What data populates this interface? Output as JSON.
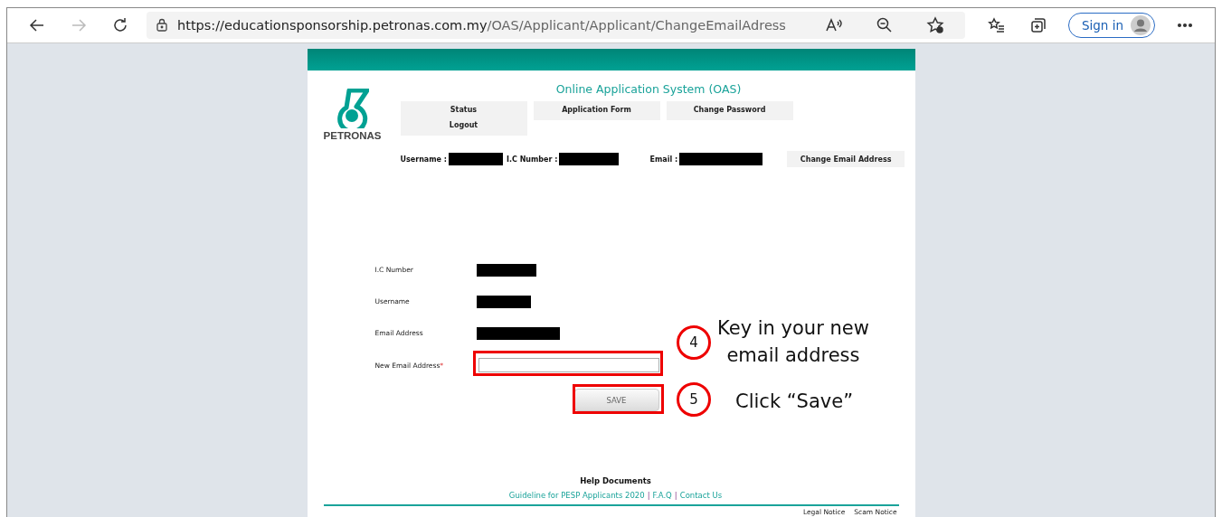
{
  "browser": {
    "url_host": "https://educationsponsorship.petronas.com.my",
    "url_path": "/OAS/Applicant/Applicant/ChangeEmailAdress",
    "sign_in": "Sign in",
    "forward_disabled": true
  },
  "header": {
    "logo_text": "PETRONAS",
    "title": "Online Application System (OAS)",
    "nav": [
      {
        "items": [
          "Status",
          "Logout"
        ]
      },
      {
        "items": [
          "Application Form"
        ]
      },
      {
        "items": [
          "Change Password"
        ]
      }
    ],
    "info": [
      {
        "label": "Username :"
      },
      {
        "label": "I.C Number :"
      },
      {
        "label": "Email :"
      }
    ],
    "change_email_button": "Change Email Address"
  },
  "form": {
    "fields": [
      {
        "label": "I.C Number",
        "kind": "redacted"
      },
      {
        "label": "Username",
        "kind": "redacted"
      },
      {
        "label": "Email Address",
        "kind": "redacted"
      },
      {
        "label": "New Email Address",
        "kind": "input",
        "required_mark": "*"
      }
    ],
    "save_button": "SAVE"
  },
  "annotations": [
    {
      "number": "4",
      "lines": [
        "Key in your new",
        "email address"
      ]
    },
    {
      "number": "5",
      "lines": [
        "Click “Save”"
      ]
    }
  ],
  "footer": {
    "help_title": "Help Documents",
    "links": [
      {
        "label": "Guideline for PESP Applicants 2020"
      },
      {
        "label": "F.A.Q"
      },
      {
        "label": "Contact Us"
      }
    ],
    "separators": [
      "|",
      "|"
    ],
    "bottom_links": [
      "Legal Notice",
      "Scam Notice"
    ]
  }
}
